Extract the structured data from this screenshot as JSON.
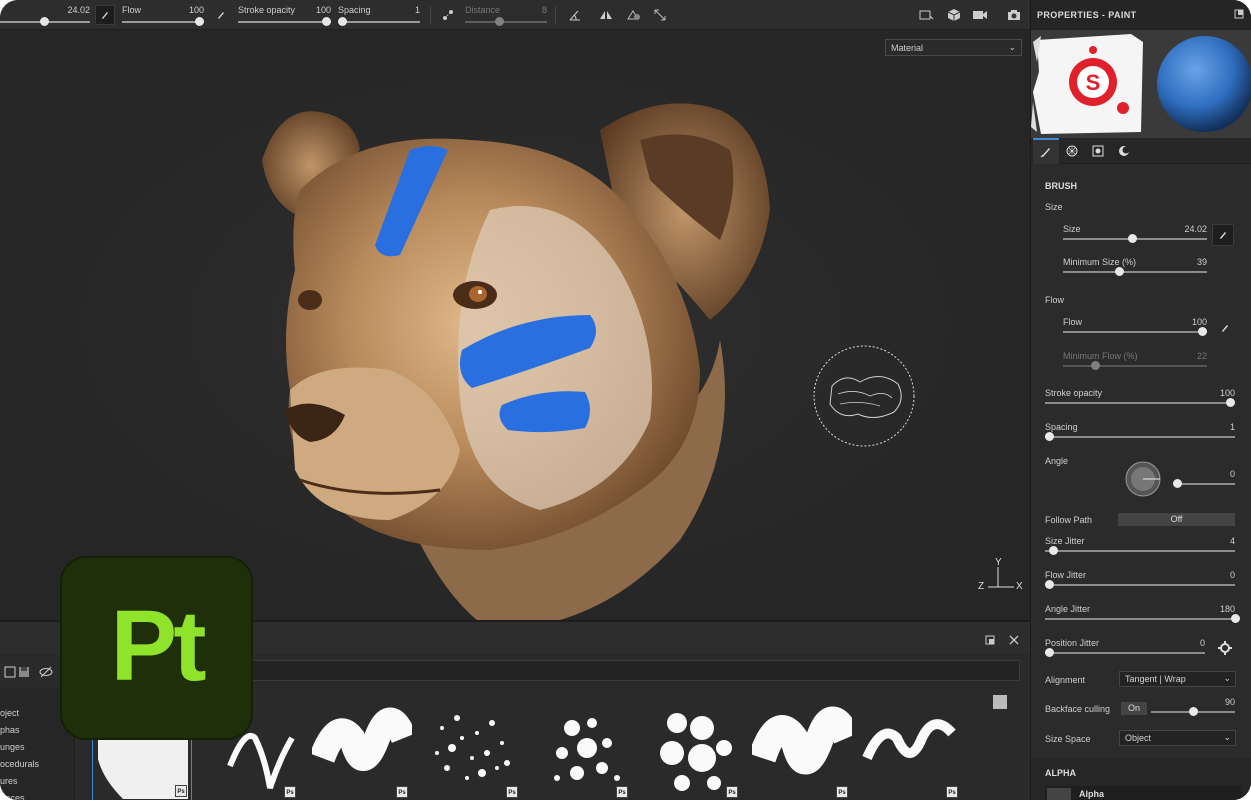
{
  "toolbar": {
    "size_value": "24.02",
    "flow_label": "Flow",
    "flow_value": "100",
    "stroke_opacity_label": "Stroke opacity",
    "stroke_opacity_value": "100",
    "spacing_label": "Spacing",
    "spacing_value": "1",
    "distance_label": "Distance",
    "distance_value": "8"
  },
  "viewport": {
    "material_select": "Material",
    "axes": {
      "x": "X",
      "y": "Y",
      "z": "Z"
    }
  },
  "panel": {
    "title": "PROPERTIES - PAINT",
    "brush_section": "BRUSH",
    "size_group": "Size",
    "size_label": "Size",
    "size_value": "24.02",
    "size_fraction": 0.48,
    "min_size_label": "Minimum Size (%)",
    "min_size_value": "39",
    "min_size_fraction": 0.39,
    "flow_group": "Flow",
    "flow_label": "Flow",
    "flow_value": "100",
    "min_flow_label": "Minimum Flow (%)",
    "min_flow_value": "22",
    "min_flow_fraction": 0.22,
    "stroke_opacity_label": "Stroke opacity",
    "stroke_opacity_value": "100",
    "spacing_label": "Spacing",
    "spacing_value": "1",
    "angle_label": "Angle",
    "angle_value": "0",
    "follow_path_label": "Follow Path",
    "follow_path_value": "Off",
    "size_jitter_label": "Size Jitter",
    "size_jitter_value": "4",
    "size_jitter_fraction": 0.04,
    "flow_jitter_label": "Flow Jitter",
    "flow_jitter_value": "0",
    "angle_jitter_label": "Angle Jitter",
    "angle_jitter_value": "180",
    "angle_jitter_fraction": 1.0,
    "position_jitter_label": "Position Jitter",
    "position_jitter_value": "0",
    "alignment_label": "Alignment",
    "alignment_value": "Tangent | Wrap",
    "backface_label": "Backface culling",
    "backface_toggle": "On",
    "backface_value": "90",
    "backface_fraction": 0.5,
    "size_space_label": "Size Space",
    "size_space_value": "Object",
    "alpha_section": "ALPHA",
    "alpha_item": "Alpha"
  },
  "shelf": {
    "list_items": [
      "oject",
      "phas",
      "unges",
      "ocedurals",
      "ures",
      "rfaces"
    ],
    "badge": "Ps"
  },
  "logo": {
    "text": "Pt",
    "bg": "#1f2f0a",
    "fg": "#8fe32b"
  },
  "colors": {
    "accent": "#3d8bd8",
    "paint_blue": "#2a6fe0"
  }
}
